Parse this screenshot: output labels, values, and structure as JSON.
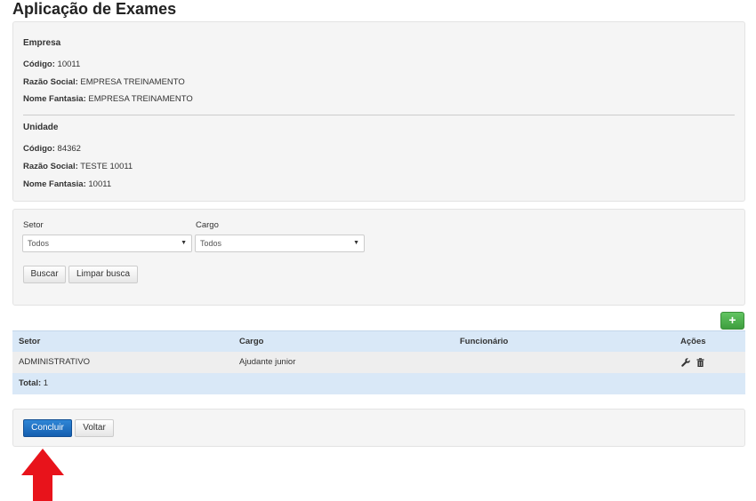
{
  "page": {
    "title": "Aplicação de Exames"
  },
  "empresa": {
    "heading": "Empresa",
    "codigo_label": "Código:",
    "codigo": "10011",
    "razao_label": "Razão Social:",
    "razao": "EMPRESA TREINAMENTO",
    "fantasia_label": "Nome Fantasia:",
    "fantasia": "EMPRESA TREINAMENTO"
  },
  "unidade": {
    "heading": "Unidade",
    "codigo_label": "Código:",
    "codigo": "84362",
    "razao_label": "Razão Social:",
    "razao": "TESTE 10011",
    "fantasia_label": "Nome Fantasia:",
    "fantasia": "10011"
  },
  "filters": {
    "setor_label": "Setor",
    "setor_value": "Todos",
    "cargo_label": "Cargo",
    "cargo_value": "Todos",
    "buscar_label": "Buscar",
    "limpar_label": "Limpar busca"
  },
  "add_button": {
    "label": "+",
    "color": "#4cae4c"
  },
  "table": {
    "columns": [
      "Setor",
      "Cargo",
      "Funcionário",
      "Ações"
    ],
    "rows": [
      {
        "setor": "ADMINISTRATIVO",
        "cargo": "Ajudante junior",
        "funcionario": ""
      }
    ],
    "total_label": "Total:",
    "total_value": "1",
    "row_icons": [
      "wrench-icon",
      "trash-icon"
    ]
  },
  "footer": {
    "concluir_label": "Concluir",
    "voltar_label": "Voltar"
  },
  "colors": {
    "primary": "#1a6fc4",
    "success": "#4cae4c",
    "table_head": "#d9e8f7",
    "arrow": "#e8131b"
  }
}
